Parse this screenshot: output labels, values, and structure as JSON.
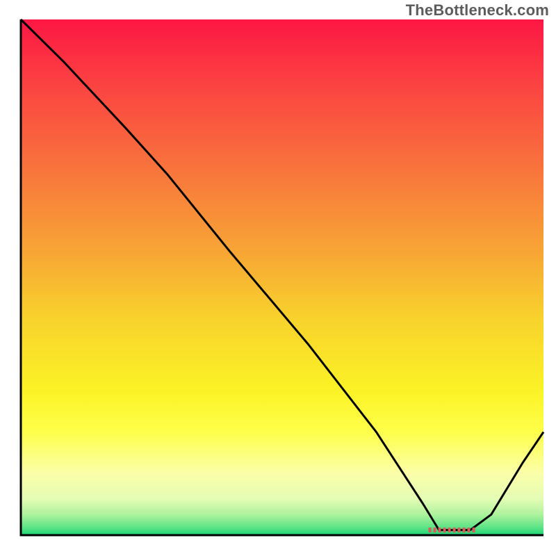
{
  "watermark": "TheBottleneck.com",
  "chart_data": {
    "type": "line",
    "notes": "Bottleneck-style V-curve plotted over a vertical red→yellow→green gradient. X axis is configuration/resolution index (0–100). Y axis is bottleneck severity (0 optimal at bottom, 100 worst at top). Flat trough near x≈80-86 marks the recommended region.",
    "xlabel": "",
    "ylabel": "",
    "xlim": [
      0,
      100
    ],
    "ylim": [
      0,
      100
    ],
    "title": "",
    "series": [
      {
        "name": "bottleneck-curve",
        "x": [
          0,
          8,
          20,
          28,
          40,
          55,
          68,
          77,
          80,
          86,
          90,
          96,
          100
        ],
        "y": [
          100,
          92,
          79,
          70,
          55,
          37,
          20,
          6,
          1,
          1,
          4,
          14,
          20
        ]
      }
    ],
    "trough_region": {
      "x_start": 78,
      "x_end": 87,
      "y": 1
    },
    "background_gradient": {
      "stops": [
        {
          "offset": 0.0,
          "color": "#fd1744"
        },
        {
          "offset": 0.14,
          "color": "#fb4741"
        },
        {
          "offset": 0.3,
          "color": "#f8773c"
        },
        {
          "offset": 0.45,
          "color": "#f7a535"
        },
        {
          "offset": 0.58,
          "color": "#f8d22c"
        },
        {
          "offset": 0.72,
          "color": "#fbf326"
        },
        {
          "offset": 0.8,
          "color": "#feff4a"
        },
        {
          "offset": 0.88,
          "color": "#fbffa9"
        },
        {
          "offset": 0.93,
          "color": "#e3fcb4"
        },
        {
          "offset": 0.96,
          "color": "#aef29d"
        },
        {
          "offset": 0.985,
          "color": "#5de386"
        },
        {
          "offset": 1.0,
          "color": "#1bd775"
        }
      ]
    },
    "axis_color": "#000000",
    "line_color": "#000000",
    "trough_marker_color": "#d85a5a"
  }
}
